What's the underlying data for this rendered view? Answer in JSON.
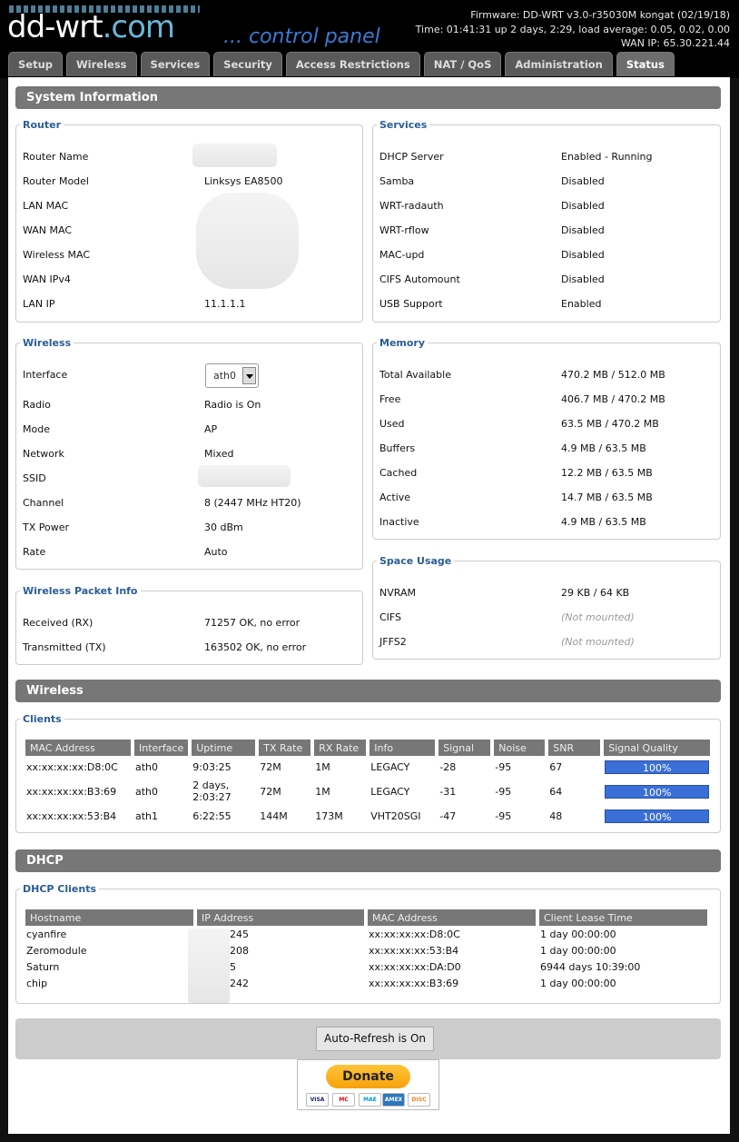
{
  "header": {
    "logo_main": "dd-wrt",
    "logo_suffix": ".com",
    "subtitle": "... control panel",
    "firmware": "Firmware: DD-WRT v3.0-r35030M kongat (02/19/18)",
    "time": "Time: 01:41:31 up 2 days, 2:29, load average: 0.05, 0.02, 0.00",
    "wan_ip": "WAN IP: 65.30.221.44"
  },
  "tabs": [
    "Setup",
    "Wireless",
    "Services",
    "Security",
    "Access Restrictions",
    "NAT / QoS",
    "Administration",
    "Status"
  ],
  "system_info": {
    "title": "System Information",
    "router": {
      "legend": "Router",
      "rows": [
        {
          "label": "Router Name",
          "value": ""
        },
        {
          "label": "Router Model",
          "value": "Linksys EA8500"
        },
        {
          "label": "LAN MAC",
          "value": ""
        },
        {
          "label": "WAN MAC",
          "value": ""
        },
        {
          "label": "Wireless MAC",
          "value": ""
        },
        {
          "label": "WAN IPv4",
          "value": ""
        },
        {
          "label": "LAN IP",
          "value": "11.1.1.1"
        }
      ]
    },
    "services": {
      "legend": "Services",
      "rows": [
        {
          "label": "DHCP Server",
          "value": "Enabled - Running"
        },
        {
          "label": "Samba",
          "value": "Disabled"
        },
        {
          "label": "WRT-radauth",
          "value": "Disabled"
        },
        {
          "label": "WRT-rflow",
          "value": "Disabled"
        },
        {
          "label": "MAC-upd",
          "value": "Disabled"
        },
        {
          "label": "CIFS Automount",
          "value": "Disabled"
        },
        {
          "label": "USB Support",
          "value": "Enabled"
        }
      ]
    },
    "wireless": {
      "legend": "Wireless",
      "interface_label": "Interface",
      "interface_value": "ath0",
      "rows": [
        {
          "label": "Radio",
          "value": "Radio is On"
        },
        {
          "label": "Mode",
          "value": "AP"
        },
        {
          "label": "Network",
          "value": "Mixed"
        },
        {
          "label": "SSID",
          "value": ""
        },
        {
          "label": "Channel",
          "value": "8 (2447 MHz HT20)"
        },
        {
          "label": "TX Power",
          "value": "30 dBm"
        },
        {
          "label": "Rate",
          "value": "Auto"
        }
      ]
    },
    "memory": {
      "legend": "Memory",
      "rows": [
        {
          "label": "Total Available",
          "value": "470.2 MB / 512.0 MB"
        },
        {
          "label": "Free",
          "value": "406.7 MB / 470.2 MB"
        },
        {
          "label": "Used",
          "value": "63.5 MB / 470.2 MB"
        },
        {
          "label": "Buffers",
          "value": "4.9 MB / 63.5 MB"
        },
        {
          "label": "Cached",
          "value": "12.2 MB / 63.5 MB"
        },
        {
          "label": "Active",
          "value": "14.7 MB / 63.5 MB"
        },
        {
          "label": "Inactive",
          "value": "4.9 MB / 63.5 MB"
        }
      ]
    },
    "packet_info": {
      "legend": "Wireless Packet Info",
      "rows": [
        {
          "label": "Received (RX)",
          "value": "71257 OK, no error"
        },
        {
          "label": "Transmitted (TX)",
          "value": "163502 OK, no error"
        }
      ]
    },
    "space_usage": {
      "legend": "Space Usage",
      "rows": [
        {
          "label": "NVRAM",
          "value": "29 KB / 64 KB"
        },
        {
          "label": "CIFS",
          "value": "(Not mounted)"
        },
        {
          "label": "JFFS2",
          "value": "(Not mounted)"
        }
      ]
    }
  },
  "wireless_section": {
    "title": "Wireless",
    "clients_legend": "Clients",
    "headers": [
      "MAC Address",
      "Interface",
      "Uptime",
      "TX Rate",
      "RX Rate",
      "Info",
      "Signal",
      "Noise",
      "SNR",
      "Signal Quality"
    ],
    "rows": [
      [
        "xx:xx:xx:xx:D8:0C",
        "ath0",
        "9:03:25",
        "72M",
        "1M",
        "LEGACY",
        "-28",
        "-95",
        "67",
        "100%"
      ],
      [
        "xx:xx:xx:xx:B3:69",
        "ath0",
        "2 days, 2:03:27",
        "72M",
        "1M",
        "LEGACY",
        "-31",
        "-95",
        "64",
        "100%"
      ],
      [
        "xx:xx:xx:xx:53:B4",
        "ath1",
        "6:22:55",
        "144M",
        "173M",
        "VHT20SGI",
        "-47",
        "-95",
        "48",
        "100%"
      ]
    ],
    "uptime_line1": "2 days,",
    "uptime_line2": "2:03:27"
  },
  "dhcp_section": {
    "title": "DHCP",
    "clients_legend": "DHCP Clients",
    "headers": [
      "Hostname",
      "IP Address",
      "MAC Address",
      "Client Lease Time"
    ],
    "rows": [
      [
        "cyanfire",
        "245",
        "xx:xx:xx:xx:D8:0C",
        "1 day 00:00:00"
      ],
      [
        "Zeromodule",
        "208",
        "xx:xx:xx:xx:53:B4",
        "1 day 00:00:00"
      ],
      [
        "Saturn",
        "5",
        "xx:xx:xx:xx:DA:D0",
        "6944 days 10:39:00"
      ],
      [
        "chip",
        "242",
        "xx:xx:xx:xx:B3:69",
        "1 day 00:00:00"
      ]
    ]
  },
  "footer": {
    "refresh_label": "Auto-Refresh is On",
    "donate_label": "Donate",
    "cards": [
      "VISA",
      "MC",
      "MAE",
      "AMEX",
      "DISC"
    ]
  },
  "colors": {
    "accent": "#2b5d96",
    "bar": "#777777",
    "signal": "#3a6fd8",
    "donate": "#ffc439"
  }
}
